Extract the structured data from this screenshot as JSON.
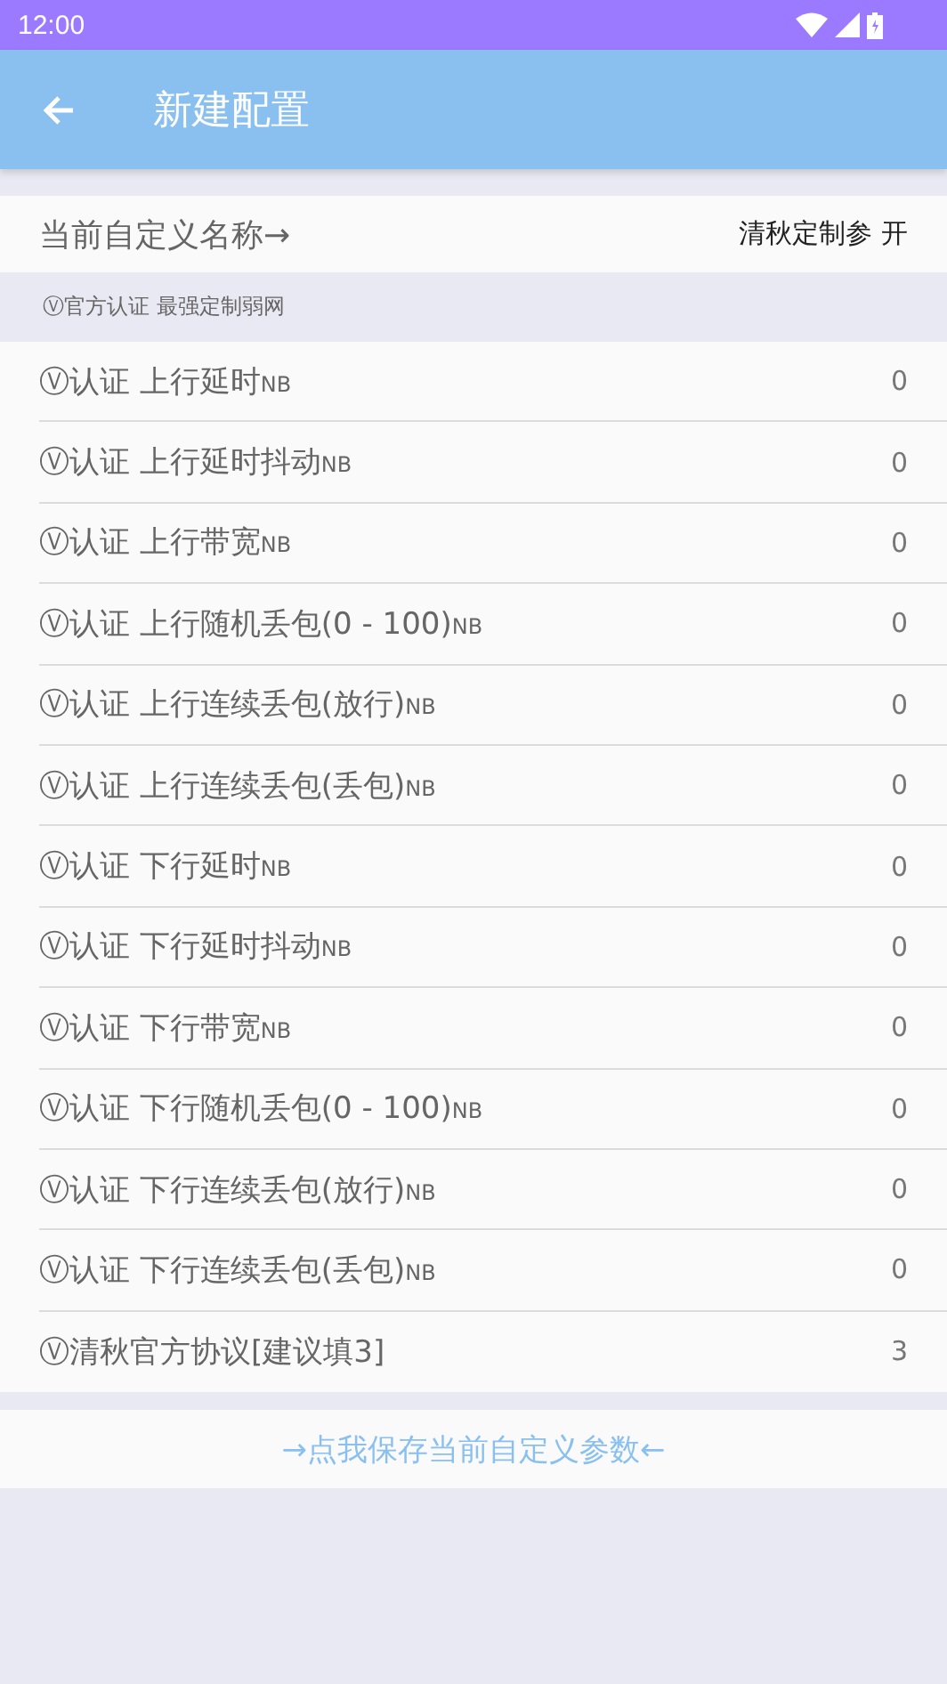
{
  "status_bar": {
    "time": "12:00"
  },
  "app_bar": {
    "title": "新建配置"
  },
  "name_row": {
    "label": "当前自定义名称→",
    "value": "清秋定制参 开"
  },
  "section": {
    "title": "Ⓥ官方认证 最强定制弱网"
  },
  "rows": [
    {
      "label": "Ⓥ认证 上行延时",
      "unit": "NB",
      "value": "0"
    },
    {
      "label": "Ⓥ认证 上行延时抖动",
      "unit": "NB",
      "value": "0"
    },
    {
      "label": "Ⓥ认证 上行带宽",
      "unit": "NB",
      "value": "0"
    },
    {
      "label": "Ⓥ认证 上行随机丢包(0 - 100)",
      "unit": "NB",
      "value": "0"
    },
    {
      "label": "Ⓥ认证 上行连续丢包(放行)",
      "unit": "NB",
      "value": "0"
    },
    {
      "label": "Ⓥ认证 上行连续丢包(丢包)",
      "unit": "NB",
      "value": "0"
    },
    {
      "label": "Ⓥ认证 下行延时",
      "unit": "NB",
      "value": "0"
    },
    {
      "label": "Ⓥ认证 下行延时抖动",
      "unit": "NB",
      "value": "0"
    },
    {
      "label": "Ⓥ认证 下行带宽",
      "unit": "NB",
      "value": "0"
    },
    {
      "label": "Ⓥ认证 下行随机丢包(0 - 100)",
      "unit": "NB",
      "value": "0"
    },
    {
      "label": "Ⓥ认证 下行连续丢包(放行)",
      "unit": "NB",
      "value": "0"
    },
    {
      "label": "Ⓥ认证 下行连续丢包(丢包)",
      "unit": "NB",
      "value": "0"
    },
    {
      "label": "Ⓥ清秋官方协议[建议填3]",
      "value": "3"
    }
  ],
  "save_button": {
    "label": "→点我保存当前自定义参数←"
  }
}
